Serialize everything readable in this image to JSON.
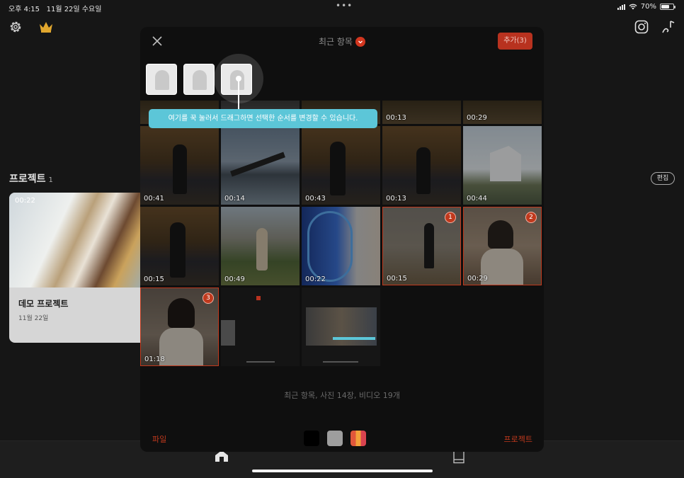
{
  "status": {
    "time": "오후 4:15",
    "date": "11월 22일 수요일",
    "battery": "70%",
    "battery_level": 0.7
  },
  "home": {
    "projects_title": "프로젝트",
    "projects_count": "1",
    "edit_label": "편집",
    "project": {
      "duration": "00:22",
      "name": "데모 프로젝트",
      "date": "11월 22일"
    }
  },
  "picker": {
    "title": "최근 항목",
    "add_label": "추가(3)",
    "tooltip": "여기를 꾹 눌러서 드래그하면 선택한 순서를 변경할 수 있습니다.",
    "summary": "최근 항목, 사진 14장, 비디오 19개",
    "footer": {
      "file_label": "파일",
      "project_label": "프로젝트"
    },
    "top_row": [
      {
        "duration": ""
      },
      {
        "duration": ""
      },
      {
        "duration": ""
      },
      {
        "duration": "00:13"
      },
      {
        "duration": "00:29"
      }
    ],
    "row2": [
      {
        "duration": "00:41"
      },
      {
        "duration": "00:14"
      },
      {
        "duration": "00:43"
      },
      {
        "duration": "00:13"
      },
      {
        "duration": "00:44"
      }
    ],
    "row3": [
      {
        "duration": "00:15"
      },
      {
        "duration": "00:49"
      },
      {
        "duration": "00:22"
      },
      {
        "duration": "00:15",
        "badge": "1"
      },
      {
        "duration": "00:29",
        "badge": "2"
      }
    ],
    "row4": [
      {
        "duration": "01:18",
        "badge": "3"
      }
    ],
    "swatch_colors": [
      "#000000",
      "#9e9e9e",
      "#e0573b"
    ]
  }
}
